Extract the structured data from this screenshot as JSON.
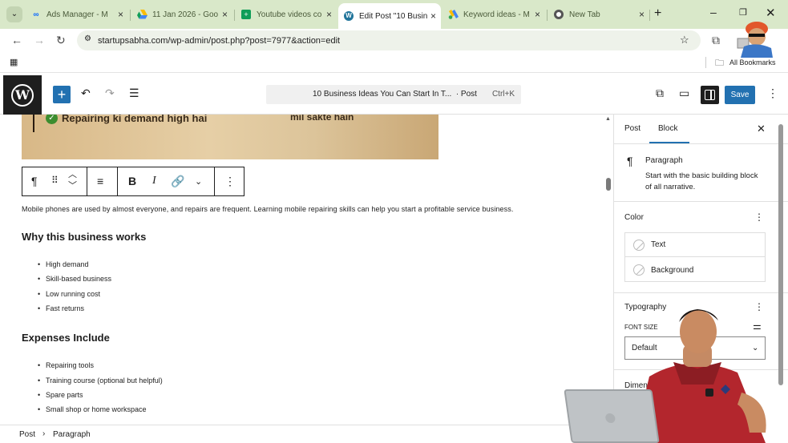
{
  "browser": {
    "tabs": [
      {
        "title": "Ads Manager - M",
        "icon": "meta-icon",
        "active": false
      },
      {
        "title": "11 Jan 2026 - Goo",
        "icon": "drive-icon",
        "active": false
      },
      {
        "title": "Youtube videos co",
        "icon": "sheets-icon",
        "active": false
      },
      {
        "title": "Edit Post \"10 Busin",
        "icon": "wordpress-icon",
        "active": true
      },
      {
        "title": "Keyword ideas - M",
        "icon": "google-ads-icon",
        "active": false
      },
      {
        "title": "New Tab",
        "icon": "chrome-icon",
        "active": false
      }
    ],
    "url": "startupsabha.com/wp-admin/post.php?post=7977&action=edit",
    "bookmarks_label": "All Bookmarks"
  },
  "editor": {
    "command_bar_title": "10 Business Ideas You Can Start In T...",
    "command_bar_type": "· Post",
    "command_bar_shortcut": "Ctrl+K",
    "save_label": "Save",
    "accent": "#2271b1"
  },
  "content": {
    "image_caption_left": "Repairing ki demand high hai",
    "image_caption_right": "mil sakte hain",
    "paragraph": "Mobile phones are used by almost everyone, and repairs are frequent. Learning mobile repairing skills can help you start a profitable service business.",
    "heading1": "Why this business works",
    "list1": [
      "High demand",
      "Skill-based business",
      "Low running cost",
      "Fast returns"
    ],
    "heading2": "Expenses Include",
    "list2": [
      "Repairing tools",
      "Training course (optional but helpful)",
      "Spare parts",
      "Small shop or home workspace"
    ]
  },
  "breadcrumb": {
    "root": "Post",
    "separator": "›",
    "current": "Paragraph"
  },
  "sidebar": {
    "tab_post": "Post",
    "tab_block": "Block",
    "block_name": "Paragraph",
    "block_desc_line1": "Start with the basic building block",
    "block_desc_line2": "of all narrative.",
    "color_heading": "Color",
    "color_text": "Text",
    "color_background": "Background",
    "typography_heading": "Typography",
    "font_size_label": "FONT SIZE",
    "font_size_value": "Default",
    "dimensions_heading": "Dimensions"
  }
}
